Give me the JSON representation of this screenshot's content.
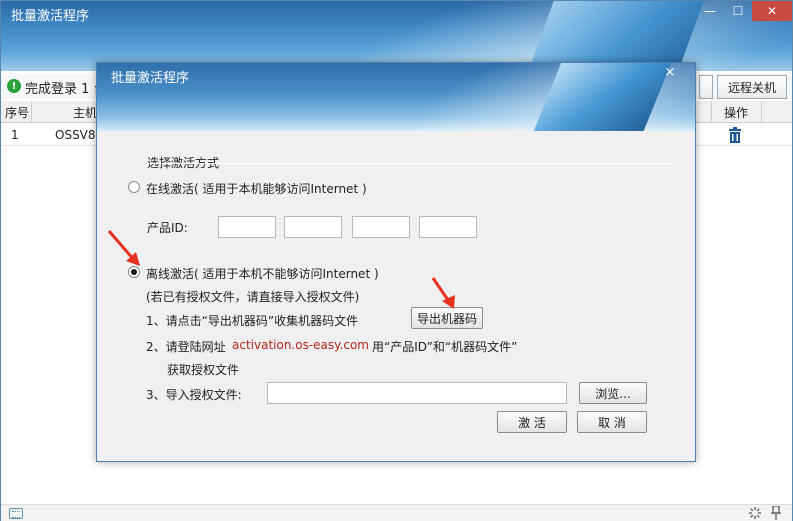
{
  "main_window": {
    "title": "批量激活程序",
    "status_text": "完成登录 1 台",
    "toolbar_right_button": "远程关机",
    "columns": [
      "序号",
      "主机",
      "操作"
    ],
    "rows": [
      {
        "index": "1",
        "host": "OSSV8-"
      }
    ],
    "icons": {
      "status": "check-circle-icon",
      "delete": "trash-icon",
      "keyboard": "keyboard-icon",
      "spinner": "spinner-icon",
      "pin": "pin-icon"
    }
  },
  "dialog": {
    "title": "批量激活程序",
    "close_glyph": "×",
    "section_label": "选择激活方式",
    "online": {
      "label": "在线激活( 适用于本机能够访问Internet )",
      "selected": false
    },
    "product_id_label": "产品ID:",
    "product_id_values": [
      "",
      "",
      "",
      ""
    ],
    "offline": {
      "label": "离线激活( 适用于本机不能够访问Internet )",
      "selected": true,
      "hint": "(若已有授权文件，请直接导入授权文件)",
      "step1": "1、请点击“导出机器码”收集机器码文件",
      "export_button": "导出机器码",
      "step2_prefix": "2、请登陆网址",
      "step2_url": "activation.os-easy.com",
      "step2_suffix": "用“产品ID”和“机器码文件”",
      "step2_line2": "获取授权文件",
      "step3": "3、导入授权文件:",
      "file_value": "",
      "browse_button": "浏览..."
    },
    "activate_button": "激  活",
    "cancel_button": "取  消"
  },
  "colors": {
    "accent": "#3d86c4",
    "url": "#b3261e",
    "arrow": "#e8301f",
    "success": "#2aa33a"
  }
}
